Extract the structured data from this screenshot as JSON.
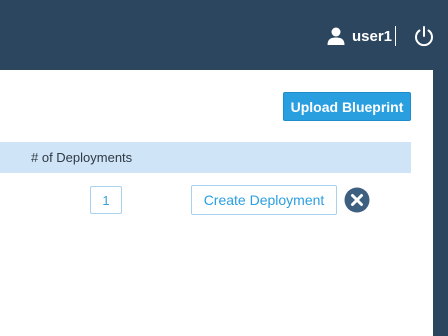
{
  "header": {
    "username": "user1",
    "icons": {
      "user": "user-icon",
      "logout": "power-icon"
    },
    "colors": {
      "bar": "#2c4660",
      "text": "#ffffff"
    }
  },
  "toolbar": {
    "upload_label": "Upload Blueprint"
  },
  "table": {
    "columns": [
      "# of Deployments"
    ],
    "rows": [
      {
        "deployments": "1",
        "create_label": "Create Deployment",
        "delete_icon": "close-circle-icon"
      }
    ]
  },
  "colors": {
    "accent": "#2a9fe0",
    "header_row": "#cfe4f6",
    "delete": "#3d5f80"
  }
}
